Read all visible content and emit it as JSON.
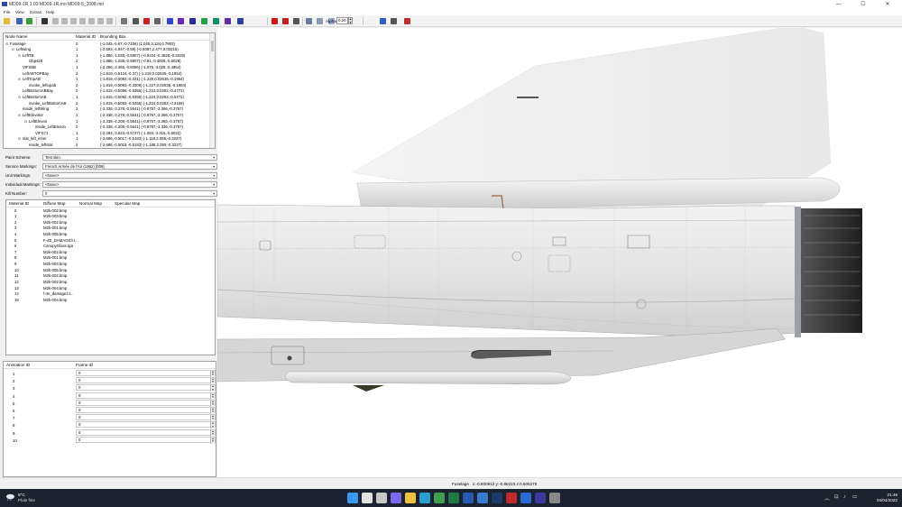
{
  "window": {
    "title": "MD09-1R 1.03  MD09-1R.mo  MD09-5_2008.mo",
    "controls": [
      "—",
      "☐",
      "✕"
    ]
  },
  "menu": [
    "File",
    "View",
    "Extras",
    "Help"
  ],
  "toolbar": {
    "alpha_label": "Alpha:",
    "alpha_value": "0.20",
    "buttons": [
      {
        "name": "open-folder-icon",
        "color": "#e8b63a"
      },
      {
        "name": "save-icon",
        "color": "#3a62b0"
      },
      {
        "name": "help-icon",
        "color": "#3a9a3a"
      },
      {
        "name": "target-icon",
        "color": "#333333"
      },
      {
        "name": "view-front-icon",
        "color": "#b8b8b8"
      },
      {
        "name": "view-back-icon",
        "color": "#b8b8b8"
      },
      {
        "name": "view-left-icon",
        "color": "#b8b8b8"
      },
      {
        "name": "view-right-icon",
        "color": "#b8b8b8"
      },
      {
        "name": "view-top-icon",
        "color": "#b8b8b8"
      },
      {
        "name": "view-bottom-icon",
        "color": "#b8b8b8"
      },
      {
        "name": "view-iso-icon",
        "color": "#b8b8b8"
      },
      {
        "name": "shade-gray-icon",
        "color": "#777777"
      },
      {
        "name": "shade-dark-icon",
        "color": "#555555"
      },
      {
        "name": "shade-red-icon",
        "color": "#d02020"
      },
      {
        "name": "shade-mixed-icon",
        "color": "#666666"
      },
      {
        "name": "color-blue-icon",
        "color": "#3344cc"
      },
      {
        "name": "color-purple-icon",
        "color": "#6a2ab0"
      },
      {
        "name": "color-navy-icon",
        "color": "#2a2a9a"
      },
      {
        "name": "color-green-icon",
        "color": "#20a040"
      },
      {
        "name": "color-teal-icon",
        "color": "#109060"
      },
      {
        "name": "color-violet-icon",
        "color": "#6030a0"
      },
      {
        "name": "color-indigo-icon",
        "color": "#2a40a0"
      },
      {
        "name": "red-sphere-icon",
        "color": "#d01818"
      },
      {
        "name": "red-dot-icon",
        "color": "#c02020"
      },
      {
        "name": "gear-icon",
        "color": "#555555"
      },
      {
        "name": "box-icon",
        "color": "#6a7aa0"
      },
      {
        "name": "wire-icon",
        "color": "#8a9ab8"
      },
      {
        "name": "grid-icon",
        "color": "#9aaad0"
      },
      {
        "name": "axes-icon",
        "color": "#2a62c0"
      },
      {
        "name": "frame-icon",
        "color": "#555555"
      },
      {
        "name": "tools-icon",
        "color": "#c03030"
      }
    ]
  },
  "tree": {
    "columns": [
      "Node Name",
      "Material ID",
      "Bounding Box"
    ],
    "rows": [
      {
        "name": "Fuselage",
        "indent": 0,
        "twisty": "⊟",
        "mat": "0",
        "box": "(-1.045,-5.67,-0.7156) (1.045,3.134,0.7903)"
      },
      {
        "name": "Leftwing",
        "indent": 1,
        "twisty": "⊟",
        "mat": "1",
        "box": "(-2.593,-4.947,-0.59) (-0.6087,2.477,0.03216)"
      },
      {
        "name": "LeftTB",
        "indent": 2,
        "twisty": "⊟",
        "mat": "1",
        "box": "(-1.886,-1.038,-0.5807) (-0.9104,-0.4828,-0.5028)"
      },
      {
        "name": "Objet28",
        "indent": 3,
        "twisty": "",
        "mat": "2",
        "box": "(-1.886,-1.038,-0.5807) (-0.91,-0.4828,-0.5028)"
      },
      {
        "name": "VIFS6B",
        "indent": 2,
        "twisty": "",
        "mat": "1",
        "box": "(-2.296,-3.366,-0.6086) (-1.076,-3.028,-0.4954)"
      },
      {
        "name": "LeftABTOPBay",
        "indent": 2,
        "twisty": "",
        "mat": "2",
        "box": "(-1.819,-0.5124,-0.37) (-1.218,0.02635,-0.1954)"
      },
      {
        "name": "LeftTopAB",
        "indent": 2,
        "twisty": "⊟",
        "mat": "1",
        "box": "(-1.819,-0.5092,-0.321) (-1.228,0.02635,-0.1954)"
      },
      {
        "name": "invoke_leftopab",
        "indent": 3,
        "twisty": "",
        "mat": "2",
        "box": "(-1.819,-0.5093,-0.3309) (-1.227,0.02635,-0.1954)"
      },
      {
        "name": "LeftBottomABBay",
        "indent": 2,
        "twisty": "",
        "mat": "2",
        "box": "(-1.815,-0.5096,-0.5356) (-1.223,0.0282,-0.4772)"
      },
      {
        "name": "LeftBottomAB",
        "indent": 2,
        "twisty": "⊟",
        "mat": "1",
        "box": "(-1.815,-0.5092,-0.5356) (-1.224,0.0282,-0.5272)"
      },
      {
        "name": "invoke_LeftBottomAB",
        "indent": 3,
        "twisty": "",
        "mat": "2",
        "box": "(-1.815,-0.5093,-0.5356) (-1.224,0.0282,-0.3168)"
      },
      {
        "name": "inside_leftWing",
        "indent": 2,
        "twisty": "",
        "mat": "2",
        "box": "(-2.338,-3.278,-0.5541) (-0.8757,-3.366,-0.3757)"
      },
      {
        "name": "LeftElevator",
        "indent": 2,
        "twisty": "⊟",
        "mat": "1",
        "box": "(-2.338,-3.278,-0.5541) (-0.8757,-3.366,-0.3757)"
      },
      {
        "name": "LeftElevon",
        "indent": 3,
        "twisty": "⊟",
        "mat": "1",
        "box": "(-2.338,-4.208,-0.5541) (-0.8757,-3.366,-0.3757)"
      },
      {
        "name": "inside_LeftElevon",
        "indent": 4,
        "twisty": "",
        "mat": "2",
        "box": "(-2.338,-4.209,-0.5541) (-0.8757,-3.336,-0.3757)"
      },
      {
        "name": "VIFS71",
        "indent": 4,
        "twisty": "",
        "mat": "1",
        "box": "(-2.284,-3.623,-0.5727) (-1.084,-3.316,-0.5022)"
      },
      {
        "name": "slat_left_inner",
        "indent": 2,
        "twisty": "⊟",
        "mat": "1",
        "box": "(-2.686,-0.5017,-0.5183) (-1.118,2.059,-0.3227)"
      },
      {
        "name": "inside_leftslat",
        "indent": 3,
        "twisty": "",
        "mat": "2",
        "box": "(-2.686,-0.5018,-0.5183) (-1.188,2.059,-0.3227)"
      }
    ]
  },
  "fields": [
    {
      "label": "Paint Scheme:",
      "value": "Test skin"
    },
    {
      "label": "Service Markings:",
      "value": "French Armée de l'Air (1962) [009]"
    },
    {
      "label": "Unit Markings:",
      "value": "<None>"
    },
    {
      "label": "Individual Markings:",
      "value": "<None>"
    },
    {
      "label": "Kill Number:",
      "value": "0"
    }
  ],
  "materials": {
    "columns": [
      "Material ID",
      "Diffuse Map",
      "Normal Map",
      "Specular Map"
    ],
    "rows": [
      {
        "id": "0",
        "diffuse": "M2k-002.bmp"
      },
      {
        "id": "1",
        "diffuse": "M2k-003.bmp"
      },
      {
        "id": "2",
        "diffuse": "M2k-002.bmp"
      },
      {
        "id": "3",
        "diffuse": "M2k-001.bmp"
      },
      {
        "id": "4",
        "diffuse": "M2k-005.bmp"
      },
      {
        "id": "5",
        "diffuse": "F-4E_DAMAGE3.t..."
      },
      {
        "id": "6",
        "diffuse": "CanopyGlass.tga"
      },
      {
        "id": "7",
        "diffuse": "M2k-002.bmp"
      },
      {
        "id": "8",
        "diffuse": "M2k-001.bmp"
      },
      {
        "id": "9",
        "diffuse": "M2k-003.bmp"
      },
      {
        "id": "10",
        "diffuse": "M2k-005.bmp"
      },
      {
        "id": "11",
        "diffuse": "M2k-002.bmp"
      },
      {
        "id": "12",
        "diffuse": "M2k-002.bmp"
      },
      {
        "id": "13",
        "diffuse": "M2k-004.bmp"
      },
      {
        "id": "14",
        "diffuse": "f-4e_damage2.t..."
      },
      {
        "id": "15",
        "diffuse": "M2k-004.bmp"
      }
    ]
  },
  "animation": {
    "columns": [
      "Animation ID",
      "Frame ID"
    ],
    "rows": [
      {
        "id": "1",
        "frame": "0"
      },
      {
        "id": "2",
        "frame": "0"
      },
      {
        "id": "3",
        "frame": "0"
      },
      {
        "id": "4",
        "frame": "0"
      },
      {
        "id": "5",
        "frame": "0"
      },
      {
        "id": "6",
        "frame": "0"
      },
      {
        "id": "7",
        "frame": "0"
      },
      {
        "id": "8",
        "frame": "0"
      },
      {
        "id": "9",
        "frame": "0"
      },
      {
        "id": "10",
        "frame": "0"
      }
    ]
  },
  "status": {
    "node": "Fuselage",
    "coords": "x:-0.600912  y:-0.86223  z:0.506276"
  },
  "taskbar": {
    "weather_temp": "8°C",
    "weather_desc": "Pluie fine",
    "time": "21:46",
    "date": "04/04/2022",
    "apps": [
      {
        "name": "windows-start-icon",
        "color": "#3a9af0"
      },
      {
        "name": "search-icon",
        "color": "#e0e0e0"
      },
      {
        "name": "task-view-icon",
        "color": "#c8c8c8"
      },
      {
        "name": "chat-icon",
        "color": "#7a6af0"
      },
      {
        "name": "file-explorer-icon",
        "color": "#f0c040"
      },
      {
        "name": "edge-icon",
        "color": "#2aa0d0"
      },
      {
        "name": "chrome-icon",
        "color": "#40a050"
      },
      {
        "name": "excel-icon",
        "color": "#1e7a40"
      },
      {
        "name": "word-icon",
        "color": "#2a5ab0"
      },
      {
        "name": "store-icon",
        "color": "#3a7ad0"
      },
      {
        "name": "photoshop-icon",
        "color": "#1a3a6a"
      },
      {
        "name": "app-red-icon",
        "color": "#c02a2a"
      },
      {
        "name": "app-blue-icon",
        "color": "#2a6ad0"
      },
      {
        "name": "app-dark-icon",
        "color": "#3a3aa0"
      },
      {
        "name": "lodviewer-icon",
        "color": "#8a8a8a"
      }
    ]
  }
}
